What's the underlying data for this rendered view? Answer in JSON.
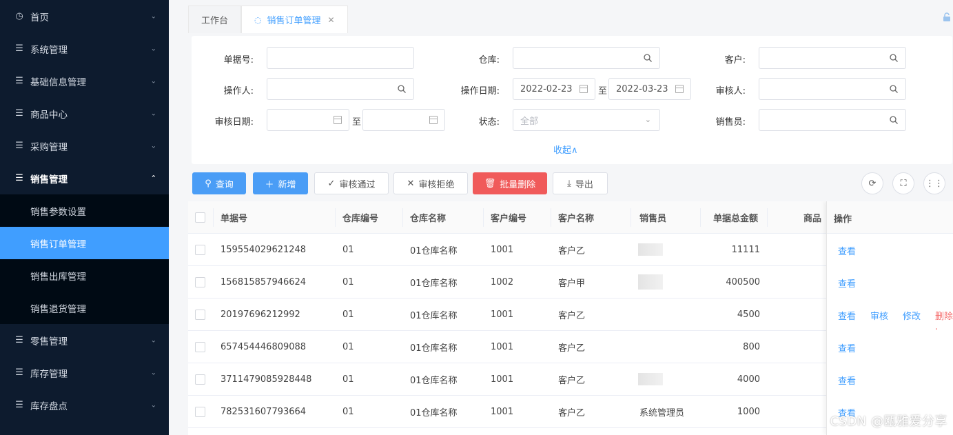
{
  "sidebar": {
    "items": [
      {
        "label": "首页",
        "icon": "dashboard-icon"
      },
      {
        "label": "系统管理",
        "icon": "menu-icon"
      },
      {
        "label": "基础信息管理",
        "icon": "menu-icon"
      },
      {
        "label": "商品中心",
        "icon": "menu-icon"
      },
      {
        "label": "采购管理",
        "icon": "menu-icon"
      },
      {
        "label": "销售管理",
        "icon": "menu-icon",
        "open": true
      },
      {
        "label": "零售管理",
        "icon": "menu-icon"
      },
      {
        "label": "库存管理",
        "icon": "menu-icon"
      },
      {
        "label": "库存盘点",
        "icon": "menu-icon"
      }
    ],
    "sub_items": [
      "销售参数设置",
      "销售订单管理",
      "销售出库管理",
      "销售退货管理"
    ],
    "active_sub": "销售订单管理"
  },
  "tabs": [
    {
      "label": "工作台"
    },
    {
      "label": "销售订单管理",
      "active": true
    }
  ],
  "filter": {
    "doc_no_label": "单据号:",
    "warehouse_label": "仓库:",
    "customer_label": "客户:",
    "operator_label": "操作人:",
    "op_date_label": "操作日期:",
    "op_date_start": "2022-02-23",
    "op_date_end": "2022-03-23",
    "auditor_label": "审核人:",
    "audit_date_label": "审核日期:",
    "status_label": "状态:",
    "status_value": "全部",
    "salesman_label": "销售员:",
    "to_text": "至",
    "collapse_label": "收起∧"
  },
  "toolbar": {
    "query": "查询",
    "add": "新增",
    "approve": "审核通过",
    "reject": "审核拒绝",
    "batch_delete": "批量删除",
    "export": "导出"
  },
  "table": {
    "headers": [
      "单据号",
      "仓库编号",
      "仓库名称",
      "客户编号",
      "客户名称",
      "销售员",
      "单据总金额",
      "商品",
      "操作"
    ],
    "rows": [
      {
        "doc_no": "159554029621248",
        "wh_code": "01",
        "wh_name": "01仓库名称",
        "cust_code": "1001",
        "cust_name": "客户乙",
        "salesman": "",
        "total": "11111",
        "ops": [
          "查看"
        ]
      },
      {
        "doc_no": "156815857946624",
        "wh_code": "01",
        "wh_name": "01仓库名称",
        "cust_code": "1002",
        "cust_name": "客户甲",
        "salesman": "",
        "total": "400500",
        "ops": [
          "查看"
        ]
      },
      {
        "doc_no": "20197696212992",
        "wh_code": "01",
        "wh_name": "01仓库名称",
        "cust_code": "1001",
        "cust_name": "客户乙",
        "salesman": "",
        "total": "4500",
        "ops": [
          "查看",
          "审核",
          "修改",
          "删除 ."
        ]
      },
      {
        "doc_no": "657454446809088",
        "wh_code": "01",
        "wh_name": "01仓库名称",
        "cust_code": "1001",
        "cust_name": "客户乙",
        "salesman": "",
        "total": "800",
        "ops": [
          "查看"
        ]
      },
      {
        "doc_no": "3711479085928448",
        "wh_code": "01",
        "wh_name": "01仓库名称",
        "cust_code": "1001",
        "cust_name": "客户乙",
        "salesman": "",
        "total": "4000",
        "ops": [
          "查看"
        ]
      },
      {
        "doc_no": "782531607793664",
        "wh_code": "01",
        "wh_name": "01仓库名称",
        "cust_code": "1001",
        "cust_name": "客户乙",
        "salesman": "系统管理员",
        "total": "1000",
        "ops": [
          "查看"
        ]
      }
    ]
  },
  "watermark": "CSDN @瓯雅爱分享",
  "colors": {
    "sidebar_bg": "#0d1b2e",
    "accent": "#409eff",
    "danger": "#f05a5a"
  }
}
